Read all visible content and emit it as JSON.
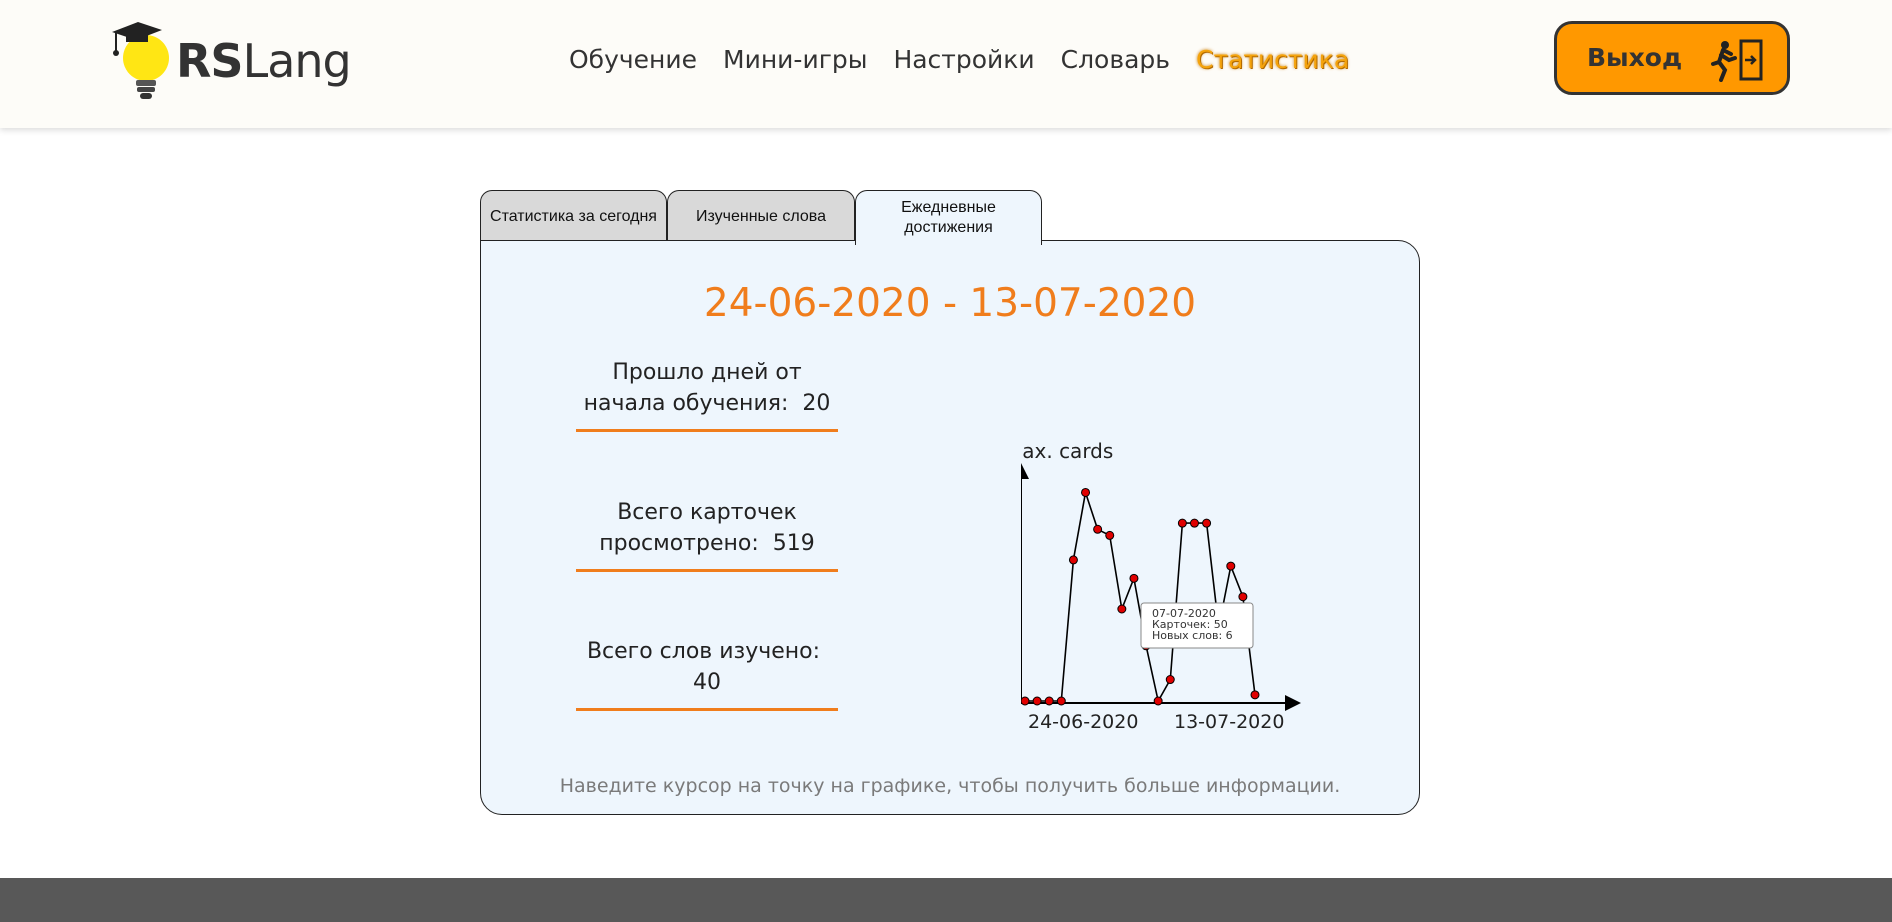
{
  "header": {
    "logo": {
      "brand_bold": "RS",
      "brand_light": "Lang"
    },
    "nav": [
      {
        "label": "Обучение",
        "active": false
      },
      {
        "label": "Мини-игры",
        "active": false
      },
      {
        "label": "Настройки",
        "active": false
      },
      {
        "label": "Словарь",
        "active": false
      },
      {
        "label": "Статистика",
        "active": true
      }
    ],
    "logout": {
      "label": "Выход",
      "icon": "exit-run-icon"
    }
  },
  "tabs": [
    {
      "label": "Статистика за сегодня",
      "active": false
    },
    {
      "label": "Изученные слова",
      "active": false
    },
    {
      "label": "Ежедневные достижения",
      "active": true
    }
  ],
  "panel": {
    "date_range": "24-06-2020 - 13-07-2020",
    "stats": [
      {
        "label": "Прошло дней от начала обучения:",
        "value": "20"
      },
      {
        "label": "Всего карточек просмотрено:",
        "value": "519"
      },
      {
        "label": "Всего слов изучено:",
        "value": "40"
      }
    ],
    "hint": "Наведите курсор на точку на графике, чтобы получить больше информации."
  },
  "chart_data": {
    "type": "line",
    "ylabel": "Max. cards",
    "x_tick_labels": [
      "24-06-2020",
      "13-07-2020"
    ],
    "x": [
      "24-06-2020",
      "25-06-2020",
      "26-06-2020",
      "27-06-2020",
      "28-06-2020",
      "29-06-2020",
      "30-06-2020",
      "01-07-2020",
      "02-07-2020",
      "03-07-2020",
      "04-07-2020",
      "05-07-2020",
      "06-07-2020",
      "07-07-2020",
      "08-07-2020",
      "09-07-2020",
      "10-07-2020",
      "11-07-2020",
      "12-07-2020",
      "13-07-2020"
    ],
    "values": [
      0,
      0,
      0,
      0,
      46,
      68,
      56,
      54,
      30,
      40,
      18,
      0,
      7,
      58,
      58,
      58,
      24,
      44,
      34,
      2
    ],
    "ylim": [
      0,
      75
    ],
    "grid": false,
    "point_color": "#e00000",
    "tooltip": {
      "date": "07-07-2020",
      "cards_line": "Карточек: 50",
      "words_line": "Новых слов: 6"
    }
  },
  "colors": {
    "accent": "#f07d1c",
    "logout_bg": "#ff9800",
    "active_nav": "#f4a30c",
    "panel_bg": "#eef6fd",
    "footer": "#585858"
  }
}
